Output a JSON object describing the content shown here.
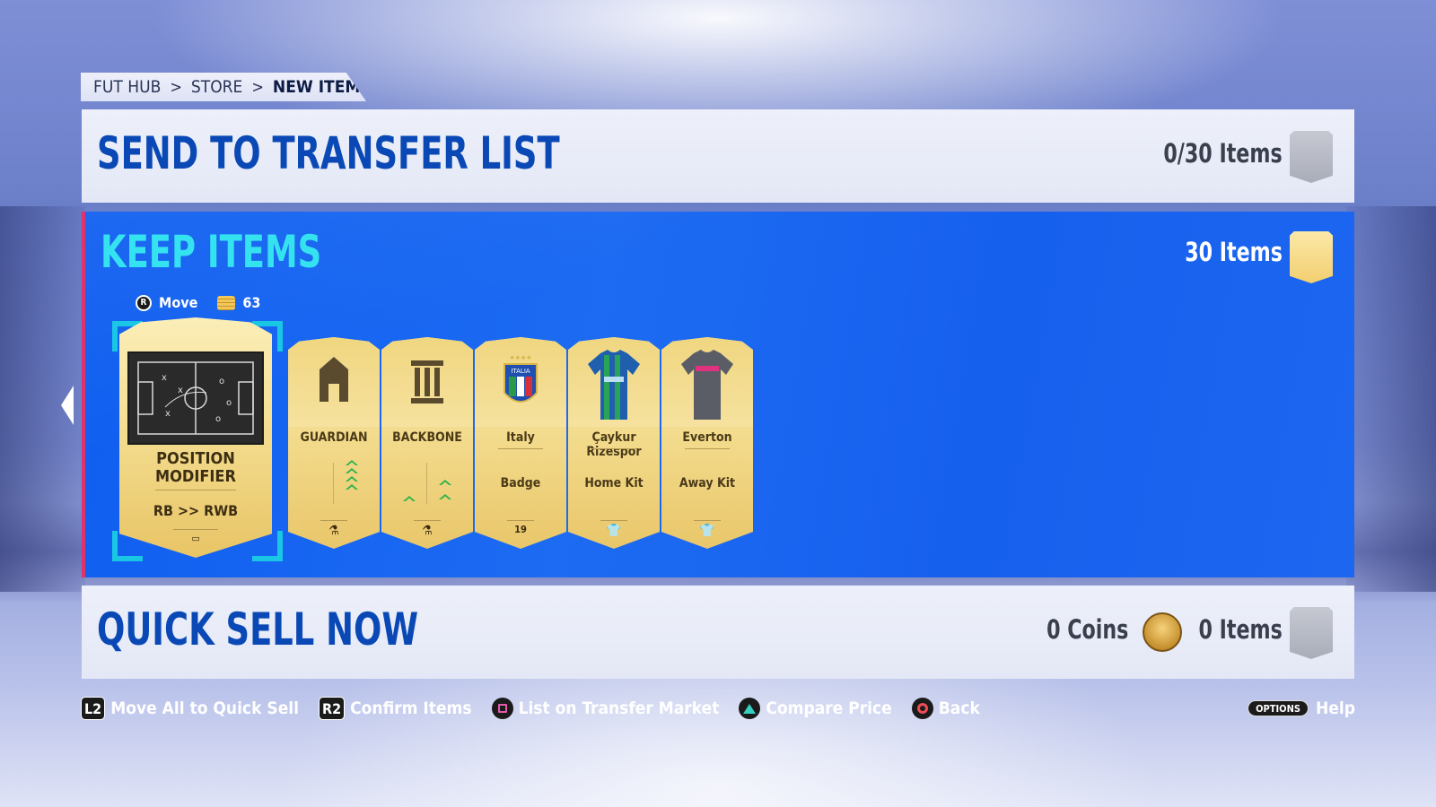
{
  "breadcrumb": {
    "items": [
      "FUT HUB",
      "STORE",
      "NEW ITEM"
    ],
    "separator": ">"
  },
  "transfer_list": {
    "title": "SEND TO TRANSFER LIST",
    "count": "0/30 Items"
  },
  "keep_items": {
    "title": "KEEP ITEMS",
    "count": "30 Items",
    "hint_move_key": "R",
    "hint_move": "Move",
    "hint_coins": "63"
  },
  "cards": [
    {
      "name": "POSITION MODIFIER",
      "sub": "RB >> RWB",
      "type": "position-modifier"
    },
    {
      "name": "GUARDIAN",
      "sub": "",
      "type": "chemistry-style"
    },
    {
      "name": "BACKBONE",
      "sub": "",
      "type": "chemistry-style"
    },
    {
      "name": "Italy",
      "sub": "Badge",
      "type": "badge",
      "foot": "19"
    },
    {
      "name": "Çaykur Rizespor",
      "sub": "Home Kit",
      "type": "kit"
    },
    {
      "name": "Everton",
      "sub": "Away Kit",
      "type": "kit"
    }
  ],
  "quick_sell": {
    "title": "QUICK SELL NOW",
    "coins": "0 Coins",
    "count": "0 Items"
  },
  "footer": {
    "actions": [
      {
        "key": "L2",
        "label": "Move All to Quick Sell"
      },
      {
        "key": "R2",
        "label": "Confirm Items"
      },
      {
        "key": "square",
        "label": "List on Transfer Market"
      },
      {
        "key": "triangle",
        "label": "Compare Price"
      },
      {
        "key": "circle",
        "label": "Back"
      }
    ],
    "options_key": "OPTIONS",
    "help": "Help"
  },
  "colors": {
    "keep_panel_bg": "#1662ee",
    "keep_title": "#35e3f0",
    "panel_title": "#0a49b5",
    "card_gold": "#f3dc8e",
    "selection": "#19c6e4",
    "accent_pink": "#e0326e"
  }
}
